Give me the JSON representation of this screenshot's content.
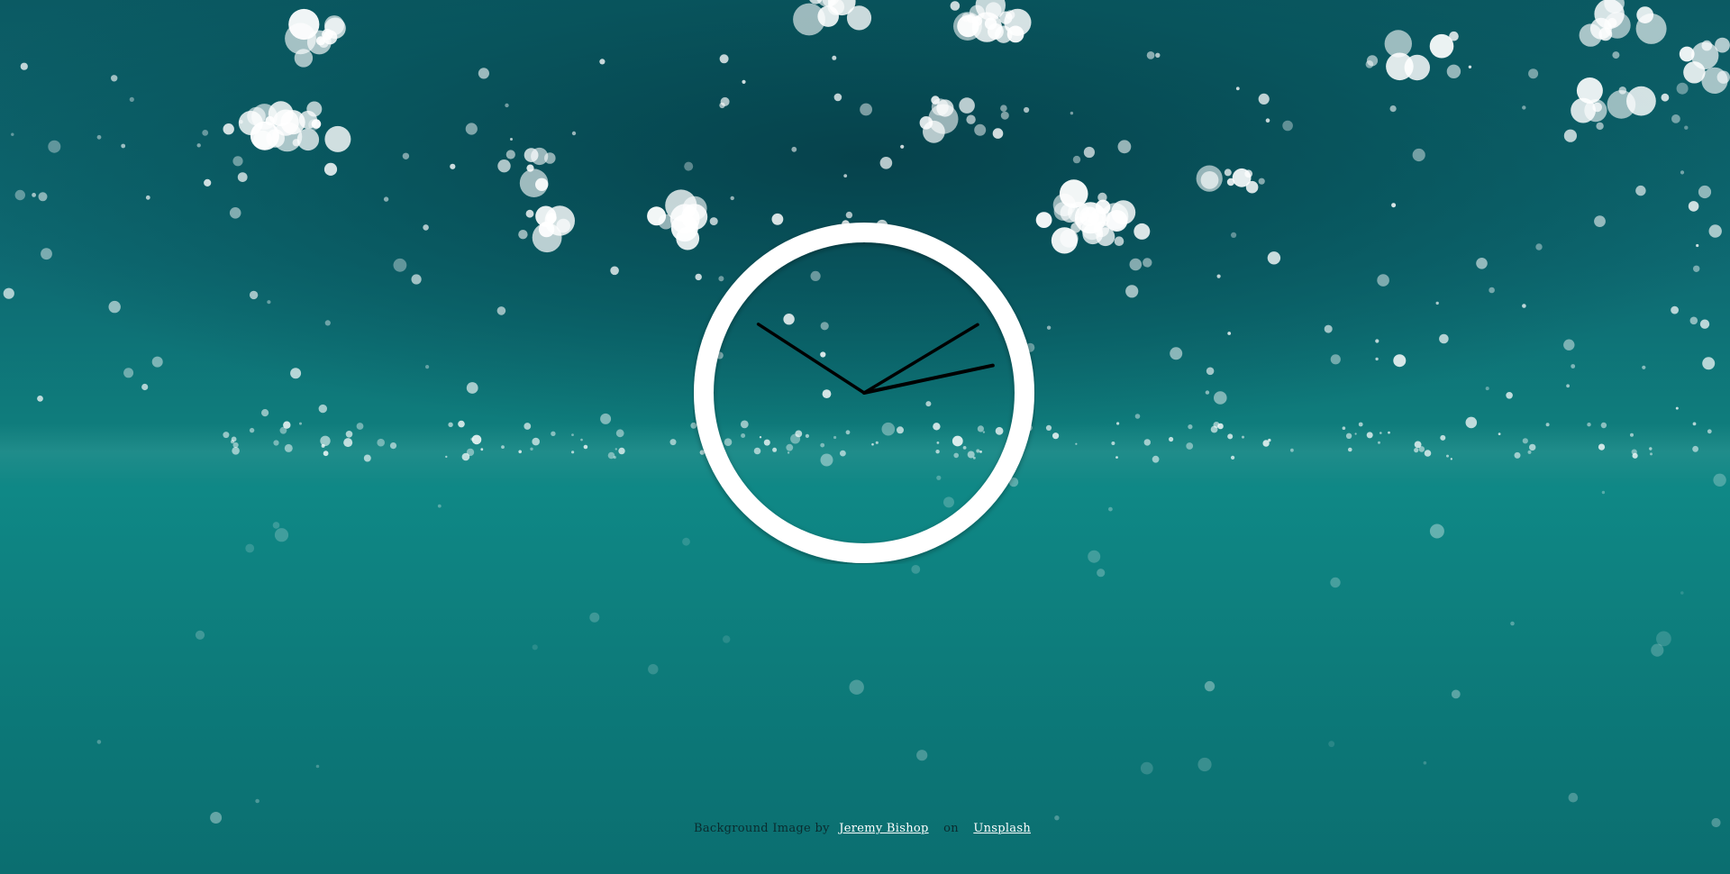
{
  "clock": {
    "hour_angle_deg": 78,
    "minute_angle_deg": 59,
    "second_angle_deg": -57,
    "colors": {
      "ring": "#ffffff",
      "hands": "#000000"
    }
  },
  "credit": {
    "prefix": "Background Image by",
    "author_link": "Jeremy Bishop",
    "joiner": "on",
    "source_link": "Unsplash"
  },
  "background": {
    "colors": {
      "deep": "#0b5a63",
      "mid": "#0f7e7d",
      "light": "#0f8886"
    }
  }
}
